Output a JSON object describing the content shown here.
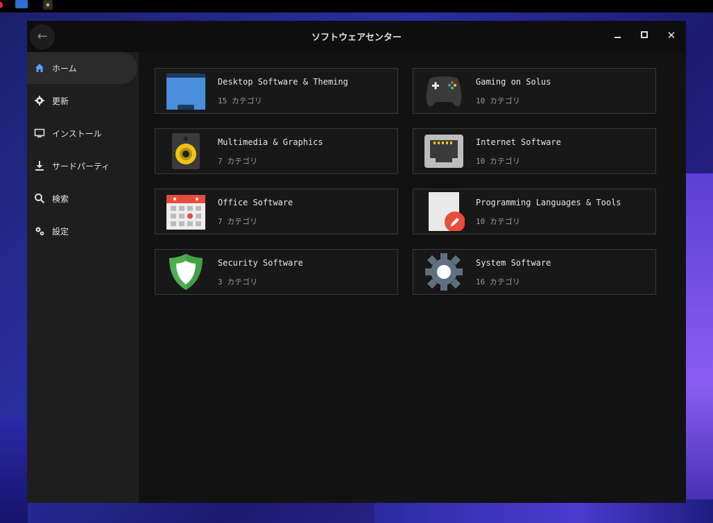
{
  "window": {
    "title": "ソフトウェアセンター"
  },
  "sidebar": {
    "items": [
      {
        "label": "ホーム"
      },
      {
        "label": "更新"
      },
      {
        "label": "インストール"
      },
      {
        "label": "サードパーティ"
      },
      {
        "label": "検索"
      },
      {
        "label": "設定"
      }
    ]
  },
  "categories": [
    {
      "title": "Desktop Software & Theming",
      "sub": "15 カテゴリ",
      "icon": "folder-icon"
    },
    {
      "title": "Gaming on Solus",
      "sub": "10 カテゴリ",
      "icon": "gamepad-icon"
    },
    {
      "title": "Multimedia & Graphics",
      "sub": "7 カテゴリ",
      "icon": "speaker-icon"
    },
    {
      "title": "Internet Software",
      "sub": "10 カテゴリ",
      "icon": "network-port-icon"
    },
    {
      "title": "Office Software",
      "sub": "7 カテゴリ",
      "icon": "calendar-icon"
    },
    {
      "title": "Programming Languages & Tools",
      "sub": "10 カテゴリ",
      "icon": "document-edit-icon"
    },
    {
      "title": "Security Software",
      "sub": "3 カテゴリ",
      "icon": "shield-icon"
    },
    {
      "title": "System Software",
      "sub": "16 カテゴリ",
      "icon": "gear-icon"
    }
  ],
  "colors": {
    "window_bg": "#141414",
    "sidebar_bg": "#1e1e1e",
    "accent_blue": "#4a8fdd",
    "accent_red": "#e74c3c",
    "accent_green": "#4caf50",
    "accent_yellow": "#f1c40f"
  }
}
